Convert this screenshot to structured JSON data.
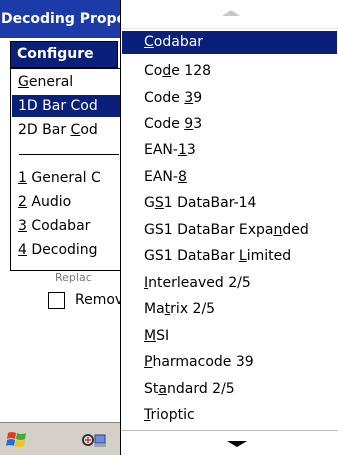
{
  "window": {
    "title": "Decoding Properties"
  },
  "configure_label": "Configure",
  "menu1": {
    "items": [
      {
        "pre": "",
        "ul": "G",
        "post": "eneral"
      },
      {
        "pre": "1D Bar Cod",
        "ul": "",
        "post": ""
      },
      {
        "pre": "2D Bar ",
        "ul": "C",
        "post": "od"
      },
      {
        "pre": "",
        "ul": "1",
        "post": " General C"
      },
      {
        "pre": "",
        "ul": "2",
        "post": " Audio"
      },
      {
        "pre": "",
        "ul": "3",
        "post": " Codabar"
      },
      {
        "pre": "",
        "ul": "4",
        "post": " Decoding"
      }
    ],
    "selected_index": 1
  },
  "background": {
    "partial_label": "Replac",
    "checkbox_label": "Remov"
  },
  "menu2": {
    "items": [
      {
        "pre": "",
        "ul": "C",
        "post": "odabar"
      },
      {
        "pre": "Co",
        "ul": "d",
        "post": "e 128"
      },
      {
        "pre": "Code ",
        "ul": "3",
        "post": "9"
      },
      {
        "pre": "Code ",
        "ul": "9",
        "post": "3"
      },
      {
        "pre": "EAN-",
        "ul": "1",
        "post": "3"
      },
      {
        "pre": "EAN-",
        "ul": "8",
        "post": ""
      },
      {
        "pre": "G",
        "ul": "S",
        "post": "1 DataBar-14"
      },
      {
        "pre": "GS1 DataBar Expa",
        "ul": "n",
        "post": "ded"
      },
      {
        "pre": "GS1 DataBar ",
        "ul": "L",
        "post": "imited"
      },
      {
        "pre": "",
        "ul": "I",
        "post": "nterleaved 2/5"
      },
      {
        "pre": "Ma",
        "ul": "t",
        "post": "rix 2/5"
      },
      {
        "pre": "",
        "ul": "M",
        "post": "SI"
      },
      {
        "pre": "",
        "ul": "P",
        "post": "harmacode 39"
      },
      {
        "pre": "St",
        "ul": "a",
        "post": "ndard 2/5"
      },
      {
        "pre": "",
        "ul": "T",
        "post": "rioptic"
      }
    ],
    "selected_index": 0
  },
  "icons": {
    "start": "windows-start-icon",
    "taskbar": "network-status-icon",
    "scroll_up": "scroll-up-arrow-icon",
    "scroll_down": "scroll-down-arrow-icon"
  }
}
